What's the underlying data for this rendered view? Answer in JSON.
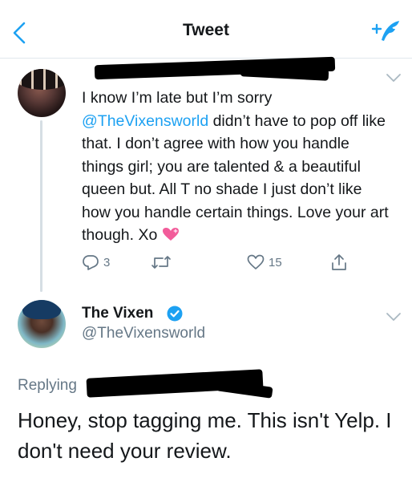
{
  "nav": {
    "title": "Tweet",
    "back_icon": "chevron-left-icon",
    "compose_icon": "compose-tweet-icon",
    "accent": "#1da1f2"
  },
  "tweet": {
    "avatar": "user-avatar",
    "mention": "@TheVixensworld",
    "text_before": "I know I’m late but I’m sorry ",
    "text_after": " didn’t have to pop off like that. I don’t agree with how you handle things girl; you are talented & a beautiful queen but. All T no shade I just don’t like how you handle certain things. Love your art though. Xo",
    "emoji": "sparkling-heart-emoji",
    "actions": {
      "reply_count": "3",
      "like_count": "15"
    }
  },
  "reply": {
    "name": "The Vixen",
    "handle": "@TheVixensworld",
    "replying_label": "Replying",
    "text": "Honey, stop tagging me. This isn't Yelp. I don't need your review.",
    "verified_color": "#1da1f2"
  }
}
